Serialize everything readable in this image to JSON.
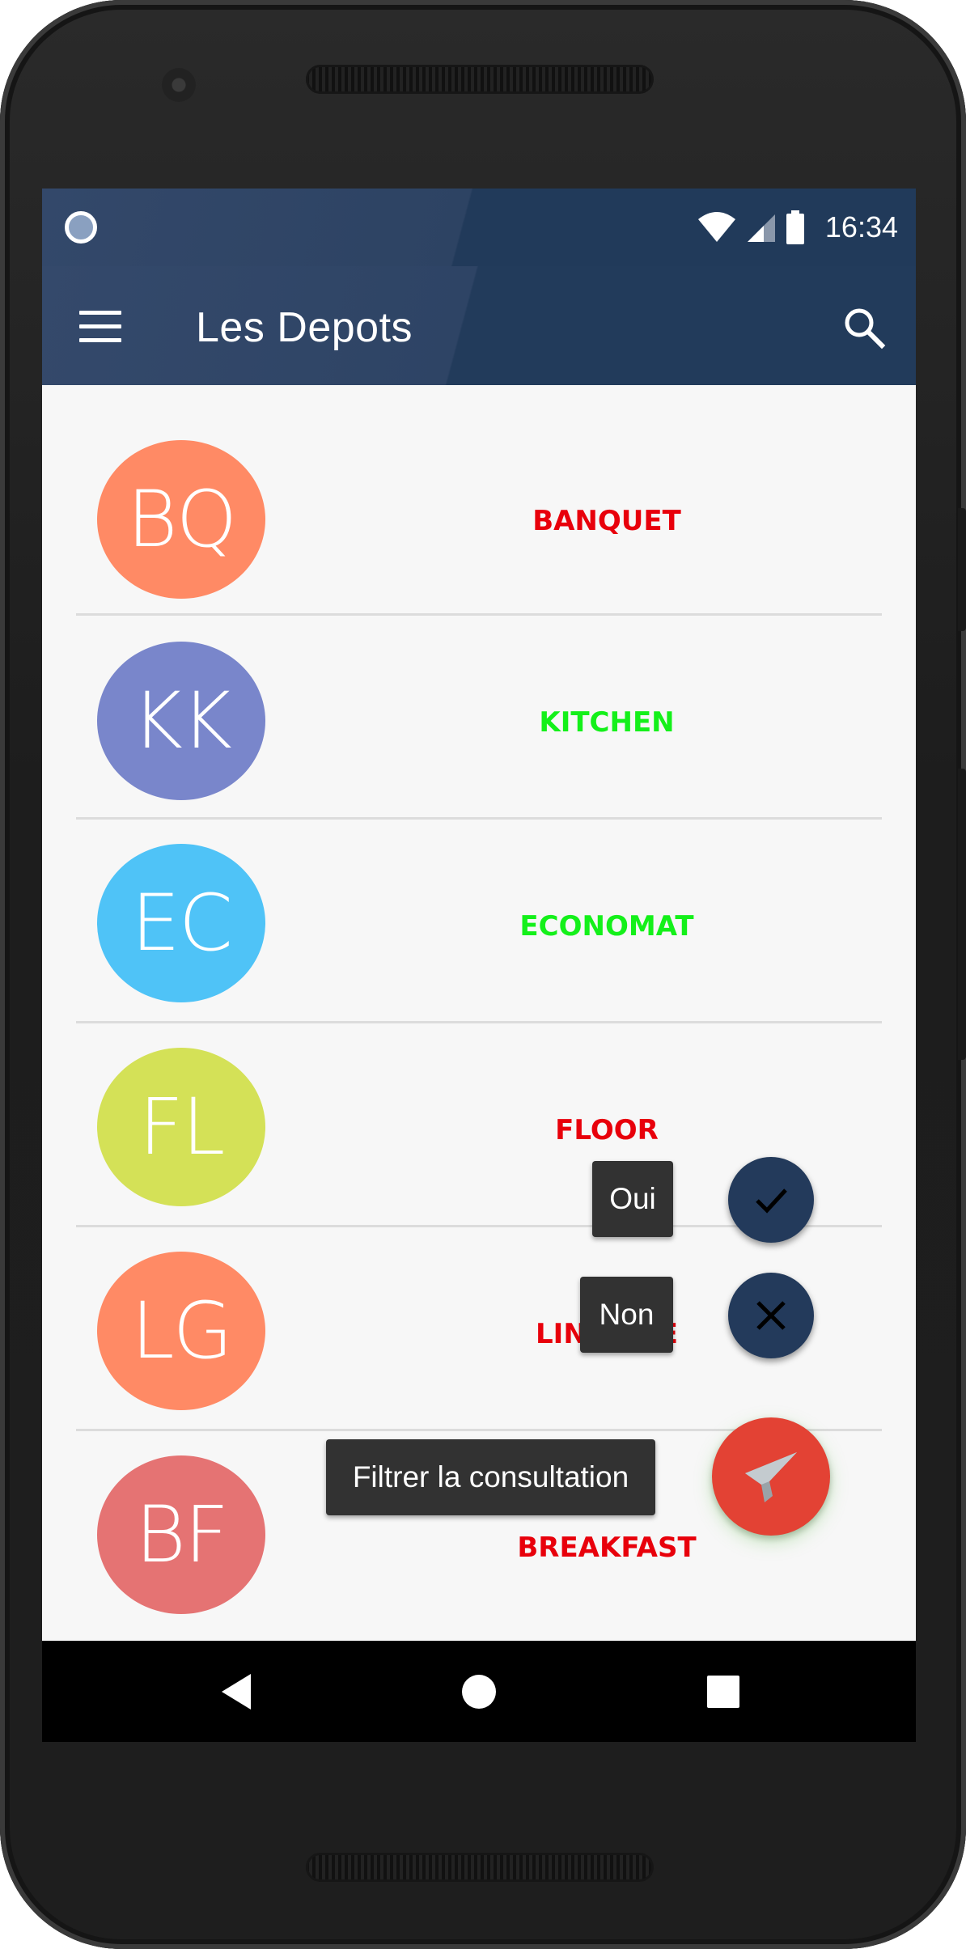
{
  "statusbar": {
    "time": "16:34",
    "icons": [
      "notification-circle-icon",
      "wifi-icon",
      "cell-signal-icon",
      "battery-icon"
    ]
  },
  "appbar": {
    "title": "Les Depots",
    "menu_icon": "menu-icon",
    "search_icon": "search-icon"
  },
  "depots": [
    {
      "initials": "BQ",
      "name": "BANQUET",
      "avatar_color": "#FF8A65",
      "label_color": "#E8000B"
    },
    {
      "initials": "KK",
      "name": "KITCHEN",
      "avatar_color": "#7986CB",
      "label_color": "#14F01A"
    },
    {
      "initials": "EC",
      "name": "ECONOMAT",
      "avatar_color": "#4FC3F7",
      "label_color": "#14F01A"
    },
    {
      "initials": "FL",
      "name": "FLOOR",
      "avatar_color": "#D4E157",
      "label_color": "#E8000B"
    },
    {
      "initials": "LG",
      "name": "LINGERIE",
      "avatar_color": "#FF8A65",
      "label_color": "#E8000B"
    },
    {
      "initials": "BF",
      "name": "BREAKFAST",
      "avatar_color": "#E57373",
      "label_color": "#E8000B"
    }
  ],
  "fab_menu": {
    "yes_label": "Oui",
    "no_label": "Non",
    "main_label": "Filtrer la consultation",
    "yes_icon": "check-icon",
    "no_icon": "close-icon",
    "main_icon": "filter-funnel-icon",
    "mini_color": "#233A5B",
    "main_color": "#E34234"
  },
  "navbar": {
    "icons": [
      "back-icon",
      "home-icon",
      "recents-icon"
    ]
  }
}
